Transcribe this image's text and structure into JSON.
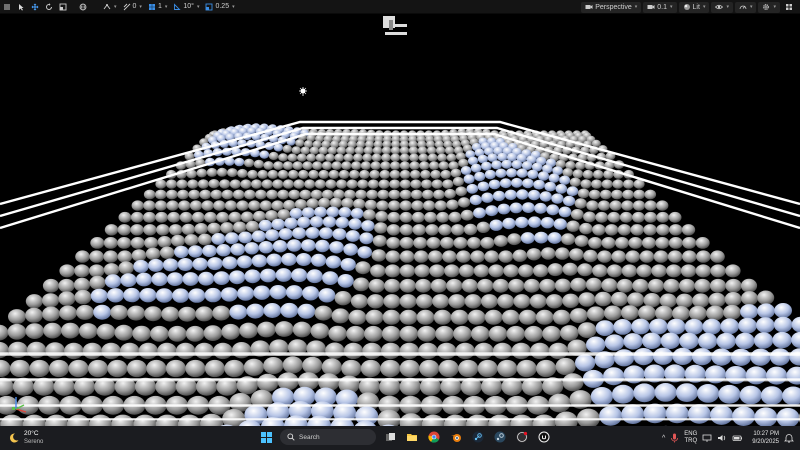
{
  "toolbar": {
    "left_items": [
      {
        "icon": "hamburger-menu-icon"
      },
      {
        "icon": "select-arrow-icon"
      },
      {
        "icon": "translate-icon"
      },
      {
        "icon": "rotate-icon"
      },
      {
        "icon": "scale-icon"
      },
      {
        "icon": "world-globe-icon"
      },
      {
        "icon": "surface-snap-icon",
        "value": "0"
      },
      {
        "icon": "grid-snap-icon",
        "value": "1"
      },
      {
        "icon": "rotation-snap-icon",
        "value": "10°"
      },
      {
        "icon": "scale-snap-icon",
        "value": "0.25"
      }
    ],
    "view_mode": "Perspective",
    "camera_speed": "0.1",
    "lighting_mode": "Lit",
    "accent_color": "#3a8ee6"
  },
  "viewport": {
    "background_color": "#000000",
    "grid_columns": 46,
    "grid_rows": 26
  },
  "taskbar": {
    "weather_temp": "20°C",
    "weather_condition": "Sereno",
    "search_placeholder": "Search",
    "apps": [
      "file-explorer-icon",
      "chrome-icon",
      "blender-icon",
      "steam-icon",
      "steam-alt-icon",
      "obs-icon",
      "unreal-engine-icon"
    ],
    "lang_top": "ENG",
    "lang_bottom": "TRQ",
    "time": "10:27 PM",
    "date": "9/20/2025"
  }
}
